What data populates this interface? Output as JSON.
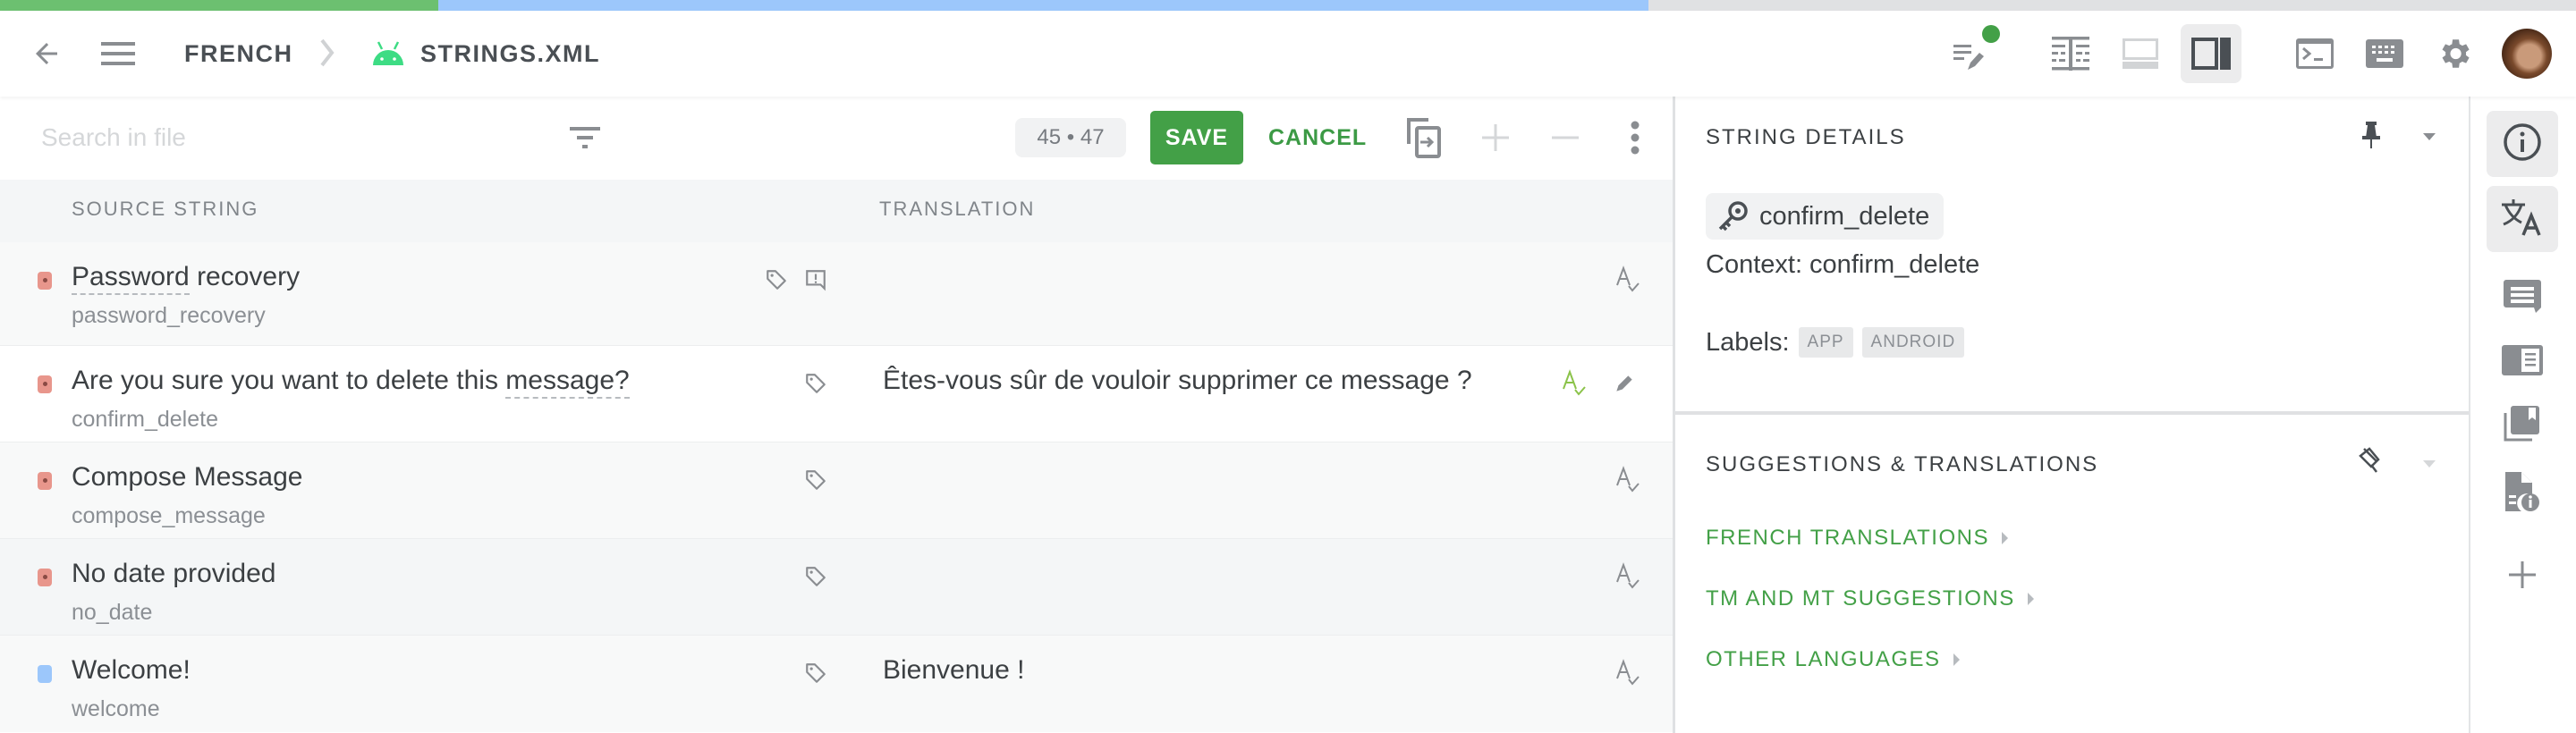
{
  "progress": {
    "translated_fraction": 0.17,
    "in_progress_fraction": 0.47,
    "colors": {
      "translated": "#6cc070",
      "in_progress": "#9cc7fb",
      "remaining": "#e0e1e3"
    }
  },
  "header": {
    "back_icon": "arrow-left-icon",
    "menu_icon": "hamburger-menu-icon",
    "breadcrumb": [
      {
        "label": "FRENCH"
      },
      {
        "label": "STRINGS.XML",
        "icon": "android-icon"
      }
    ],
    "tools": [
      {
        "name": "edit-notes-icon",
        "badge": "green-dot"
      },
      {
        "name": "side-by-side-view-icon"
      },
      {
        "name": "bottom-panel-view-icon"
      },
      {
        "name": "right-panel-view-icon",
        "active": true
      },
      {
        "name": "terminal-icon"
      },
      {
        "name": "keyboard-icon"
      },
      {
        "name": "settings-gear-icon"
      },
      {
        "name": "user-avatar"
      }
    ]
  },
  "toolbar": {
    "search_placeholder": "Search in file",
    "search_value": "",
    "counter": "45 • 47",
    "save_label": "SAVE",
    "cancel_label": "CANCEL",
    "accent": "#43a047"
  },
  "table": {
    "columns": [
      "SOURCE STRING",
      "TRANSLATION"
    ],
    "rows": [
      {
        "source": "Password recovery",
        "source_underlined": "Password",
        "key": "password_recovery",
        "translation": "",
        "status": "untranslated",
        "icons": [
          "tag-icon",
          "comment-alert-icon"
        ],
        "selected": false
      },
      {
        "source_before": "Are you sure you want to delete this ",
        "source_underlined": "message?",
        "source": "Are you sure you want to delete this message?",
        "key": "confirm_delete",
        "translation": "Êtes-vous sûr de vouloir supprimer ce message ?",
        "status": "untranslated",
        "icons": [
          "tag-icon"
        ],
        "selected": true
      },
      {
        "source": "Compose Message",
        "key": "compose_message",
        "translation": "",
        "status": "untranslated",
        "icons": [
          "tag-icon"
        ],
        "selected": false
      },
      {
        "source": "No date provided",
        "key": "no_date",
        "translation": "",
        "status": "untranslated",
        "icons": [
          "tag-icon"
        ],
        "selected": false
      },
      {
        "source": "Welcome!",
        "key": "welcome",
        "translation": "Bienvenue !",
        "status": "translated",
        "icons": [
          "tag-icon"
        ],
        "selected": false
      }
    ],
    "status_colors": {
      "untranslated": "#e8968c",
      "translated": "#9cc7fb"
    }
  },
  "details": {
    "title": "STRING DETAILS",
    "key": "confirm_delete",
    "context_label": "Context: confirm_delete",
    "labels_label": "Labels:",
    "labels": [
      "APP",
      "ANDROID"
    ]
  },
  "suggestions": {
    "title": "SUGGESTIONS & TRANSLATIONS",
    "links": [
      "FRENCH TRANSLATIONS",
      "TM AND MT SUGGESTIONS",
      "OTHER LANGUAGES"
    ]
  },
  "sidebar": {
    "items": [
      {
        "name": "info-icon",
        "active": true
      },
      {
        "name": "translate-icon",
        "active": true
      },
      {
        "name": "comments-icon",
        "active": false
      },
      {
        "name": "glossary-icon",
        "active": false
      },
      {
        "name": "translation-memory-icon",
        "active": false
      },
      {
        "name": "file-info-icon",
        "active": false
      },
      {
        "name": "add-icon",
        "active": false
      }
    ]
  }
}
